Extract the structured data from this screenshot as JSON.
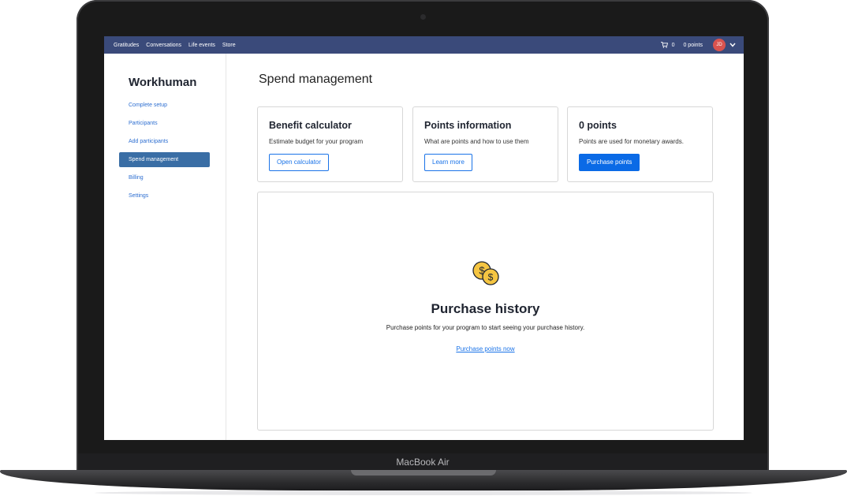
{
  "device": {
    "label": "MacBook Air"
  },
  "topbar": {
    "nav": [
      "Gratitudes",
      "Conversations",
      "Life events",
      "Store"
    ],
    "cart_count": "0",
    "points": "0 points",
    "avatar_initials": "JD"
  },
  "sidebar": {
    "brand": "Workhuman",
    "items": [
      {
        "label": "Complete setup",
        "active": false
      },
      {
        "label": "Participants",
        "active": false
      },
      {
        "label": "Add participants",
        "active": false
      },
      {
        "label": "Spend management",
        "active": true
      },
      {
        "label": "Billing",
        "active": false
      },
      {
        "label": "Settings",
        "active": false
      }
    ]
  },
  "main": {
    "title": "Spend management",
    "cards": [
      {
        "title": "Benefit calculator",
        "description": "Estimate budget for your program",
        "button": "Open calculator"
      },
      {
        "title": "Points information",
        "description": "What are points and how to use them",
        "button": "Learn more"
      },
      {
        "title": "0 points",
        "description": "Points are used for monetary awards.",
        "button": "Purchase points"
      }
    ],
    "history": {
      "title": "Purchase history",
      "description": "Purchase points for your program to start seeing your purchase history.",
      "link": "Purchase points now"
    }
  },
  "colors": {
    "topbar": "#3a4a7a",
    "accent": "#0a6ae6",
    "sidebar_active": "#3a6ea5",
    "avatar": "#d9534f",
    "coin": "#f5c542"
  }
}
